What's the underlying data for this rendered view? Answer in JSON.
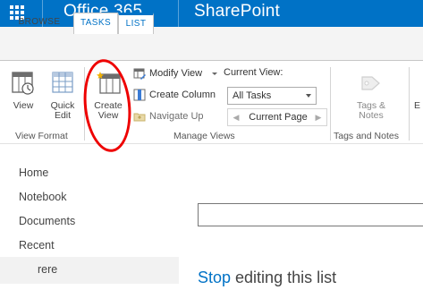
{
  "suitebar": {
    "product": "Office 365",
    "app": "SharePoint",
    "bg_color": "#0072c6"
  },
  "tabs": [
    {
      "label": "BROWSE"
    },
    {
      "label": "TASKS"
    },
    {
      "label": "LIST"
    }
  ],
  "ribbon": {
    "view_format": {
      "group_label": "View Format",
      "view_label": "View",
      "quick_edit_line1": "Quick",
      "quick_edit_line2": "Edit"
    },
    "manage_views": {
      "group_label": "Manage Views",
      "create_view_line1": "Create",
      "create_view_line2": "View",
      "modify_view": "Modify View",
      "create_column": "Create Column",
      "navigate_up": "Navigate Up",
      "current_view_label": "Current View:",
      "current_view_value": "All Tasks",
      "current_page": "Current Page"
    },
    "tags_notes": {
      "group_label": "Tags and Notes",
      "tags_line1": "Tags &",
      "tags_line2": "Notes"
    },
    "truncated_next": "E"
  },
  "quicklaunch": {
    "items": [
      "Home",
      "Notebook",
      "Documents",
      "Recent"
    ],
    "sub_items": [
      "rere"
    ]
  },
  "main": {
    "stop_link": "Stop",
    "stop_rest": " editing this list"
  },
  "annotation_color": "#ee0000"
}
